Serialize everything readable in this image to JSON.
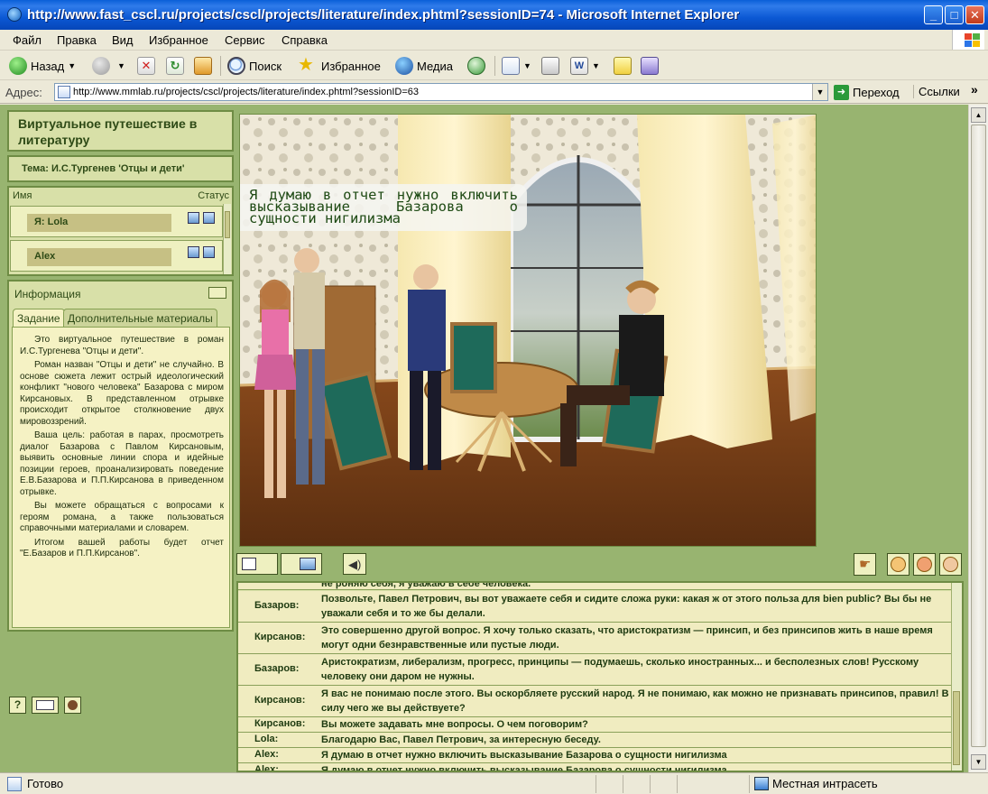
{
  "window": {
    "title": "http://www.fast_cscl.ru/projects/cscl/projects/literature/index.phtml?sessionID=74 - Microsoft Internet Explorer",
    "minimize": "_",
    "maximize": "□",
    "close": "✕"
  },
  "menu": [
    "Файл",
    "Правка",
    "Вид",
    "Избранное",
    "Сервис",
    "Справка"
  ],
  "toolbar": {
    "back": "Назад",
    "search": "Поиск",
    "favorites": "Избранное",
    "media": "Медиа"
  },
  "address": {
    "label": "Адрес:",
    "url": "http://www.mmlab.ru/projects/cscl/projects/literature/index.phtml?sessionID=63",
    "go": "Переход",
    "links": "Ссылки",
    "links_more": "»"
  },
  "sidebar": {
    "title": "Виртуальное путешествие в литературу",
    "topic": "Тема:  И.С.Тургенев 'Отцы и дети'",
    "users_header": {
      "name": "Имя",
      "status": "Статус"
    },
    "users": [
      {
        "name": "Я: Lola"
      },
      {
        "name": "Alex"
      }
    ],
    "info_title": "Информация",
    "tabs": [
      "Задание",
      "Дополнительные материалы"
    ],
    "task_paragraphs": [
      "Это виртуальное путешествие в роман И.С.Тургенева \"Отцы и дети\".",
      "Роман назван \"Отцы и дети\" не случайно. В основе сюжета лежит острый идеологический конфликт \"нового человека\" Базарова с миром Кирсановых. В представленном отрывке происходит открытое столкновение двух мировоззрений.",
      "Ваша цель: работая в парах, просмотреть диалог Базарова с Павлом Кирсановым, выявить основные линии спора и идейные позиции героев, проанализировать поведение Е.В.Базарова и П.П.Кирсанова в приведенном отрывке.",
      "Вы можете обращаться с вопросами к героям романа, а также пользоваться справочными материалами и словарем.",
      "Итогом вашей работы будет отчет \"Е.Базаров и П.П.Кирсанов\"."
    ],
    "help_label": "?"
  },
  "scene": {
    "speech": "Я думаю в отчет нужно включить высказывание Базарова о сущности нигилизма"
  },
  "chat": {
    "partial_top": "не роняю себя, я уважаю в себе человека.",
    "rows": [
      {
        "speaker": "Базаров:",
        "text": "Позвольте, Павел Петрович, вы вот уважаете себя и сидите сложа руки: какая ж от этого польза для bien public? Вы бы не уважали себя и то же бы делали."
      },
      {
        "speaker": "Кирсанов:",
        "text": "Это совершенно другой вопрос. Я хочу только сказать, что аристократизм — принсип, и без принсипов жить в наше время могут одни безнравственные или пустые люди."
      },
      {
        "speaker": "Базаров:",
        "text": "Аристократизм, либерализм, прогресс, принципы — подумаешь, сколько иностранных... и бесполезных слов! Русскому человеку они даром не нужны."
      },
      {
        "speaker": "Кирсанов:",
        "text": "Я вас не понимаю после этого. Вы оскорбляете русский народ. Я не понимаю, как можно не признавать принсипов, правил! В силу чего же вы действуете?"
      },
      {
        "speaker": "Кирсанов:",
        "text": "Вы можете задавать мне вопросы. О чем поговорим?"
      },
      {
        "speaker": "Lola:",
        "text": "Благодарю Вас, Павел Петрович, за интересную беседу."
      },
      {
        "speaker": "Alex:",
        "text": "Я думаю в отчет нужно включить высказывание Базарова о сущности нигилизма"
      },
      {
        "speaker": "Alex:",
        "text": "Я думаю в отчет нужно включить высказывание Базарова о сущности нигилизма"
      }
    ]
  },
  "status": {
    "text": "Готово",
    "zone": "Местная интрасеть"
  }
}
